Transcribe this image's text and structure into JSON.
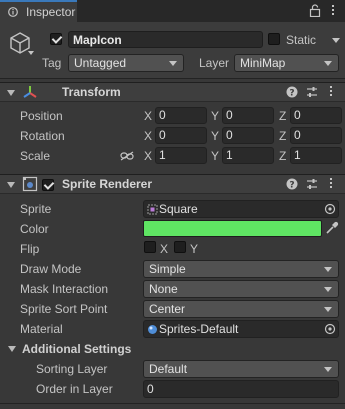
{
  "tab": {
    "label": "Inspector"
  },
  "gameobject": {
    "name": "MapIcon",
    "active": true,
    "static_label": "Static",
    "static_checked": false,
    "tag_label": "Tag",
    "tag_value": "Untagged",
    "layer_label": "Layer",
    "layer_value": "MiniMap"
  },
  "transform": {
    "title": "Transform",
    "rows": [
      {
        "label": "Position",
        "x": "0",
        "y": "0",
        "z": "0"
      },
      {
        "label": "Rotation",
        "x": "0",
        "y": "0",
        "z": "0"
      },
      {
        "label": "Scale",
        "x": "1",
        "y": "1",
        "z": "1"
      }
    ],
    "axis_x": "X",
    "axis_y": "Y",
    "axis_z": "Z"
  },
  "sprite_renderer": {
    "title": "Sprite Renderer",
    "enabled": true,
    "sprite_label": "Sprite",
    "sprite_value": "Square",
    "color_label": "Color",
    "color_value": "#5fe563",
    "flip_label": "Flip",
    "flip_x": "X",
    "flip_y": "Y",
    "draw_mode_label": "Draw Mode",
    "draw_mode_value": "Simple",
    "mask_label": "Mask Interaction",
    "mask_value": "None",
    "sort_point_label": "Sprite Sort Point",
    "sort_point_value": "Center",
    "material_label": "Material",
    "material_value": "Sprites-Default",
    "additional_label": "Additional Settings",
    "sorting_layer_label": "Sorting Layer",
    "sorting_layer_value": "Default",
    "order_label": "Order in Layer",
    "order_value": "0"
  },
  "colors": {
    "background": "#383838",
    "tab_accent": "#3a79bb",
    "color_swatch": "#5fe563"
  }
}
